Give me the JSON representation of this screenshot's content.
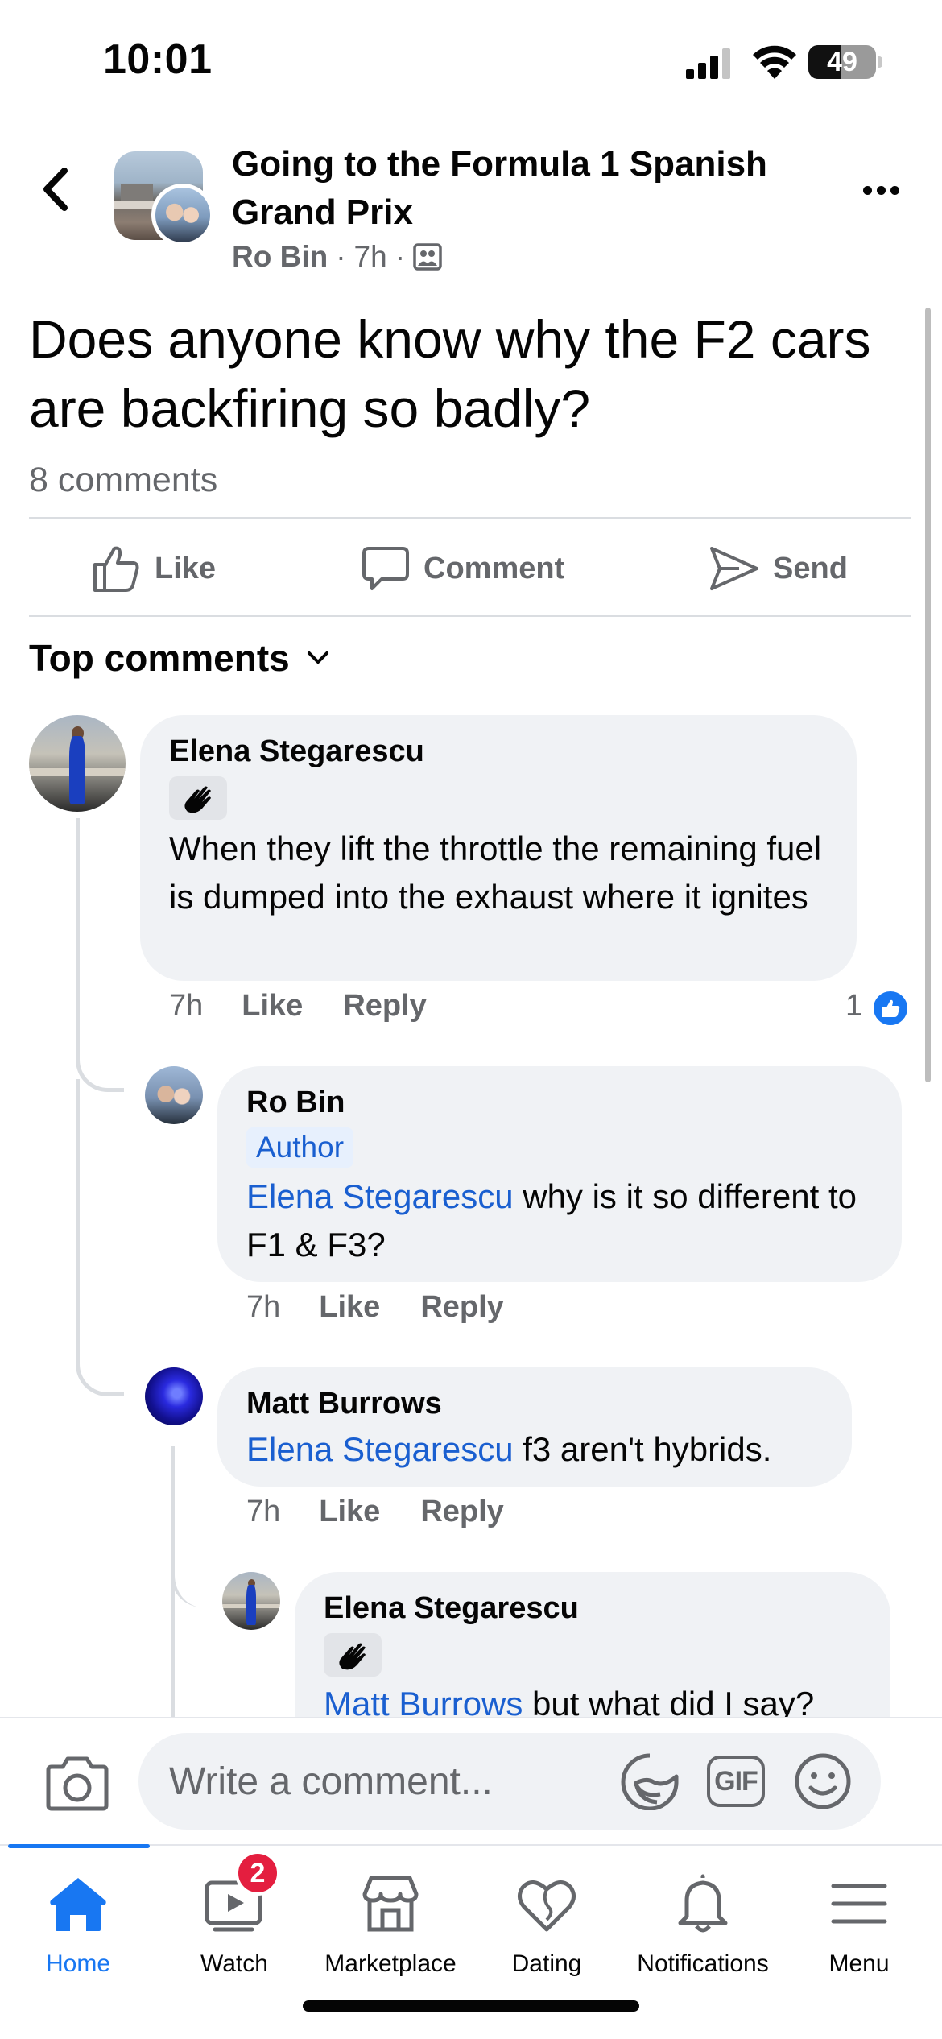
{
  "status_bar": {
    "time": "10:01",
    "battery_level": "49"
  },
  "header": {
    "group_title": "Going to the Formula 1 Spanish Grand Prix",
    "author": "Ro Bin",
    "time": "7h"
  },
  "post": {
    "text": "Does anyone know why the F2 cars are backfiring so badly?",
    "comment_count": "8 comments"
  },
  "actions": {
    "like": "Like",
    "comment": "Comment",
    "send": "Send"
  },
  "comments_section": {
    "sort_label": "Top comments"
  },
  "comments": [
    {
      "author": "Elena Stegarescu",
      "text": "When they lift the throttle the remaining fuel is dumped into the exhaust where it ignites",
      "time": "7h",
      "like": "Like",
      "reply": "Reply",
      "reaction_count": "1"
    },
    {
      "author": "Ro Bin",
      "badge": "Author",
      "mention": "Elena Stegarescu",
      "text": " why is it so different to F1 & F3?",
      "time": "7h",
      "like": "Like",
      "reply": "Reply"
    },
    {
      "author": "Matt Burrows",
      "mention": "Elena Stegarescu",
      "text": " f3 aren't hybrids.",
      "time": "7h",
      "like": "Like",
      "reply": "Reply"
    },
    {
      "author": "Elena Stegarescu",
      "mention": "Matt Burrows",
      "text": " but what did I say?"
    }
  ],
  "composer": {
    "placeholder": "Write a comment...",
    "gif_label": "GIF"
  },
  "tabbar": {
    "active": "Home",
    "items": [
      {
        "label": "Home",
        "icon": "home-icon"
      },
      {
        "label": "Watch",
        "icon": "watch-icon",
        "badge": "2"
      },
      {
        "label": "Marketplace",
        "icon": "marketplace-icon"
      },
      {
        "label": "Dating",
        "icon": "dating-icon"
      },
      {
        "label": "Notifications",
        "icon": "bell-icon"
      },
      {
        "label": "Menu",
        "icon": "menu-icon"
      }
    ]
  },
  "colors": {
    "accent": "#1877f2",
    "mention": "#1a5fd0",
    "bubble": "#f0f2f5",
    "badge_red": "#e41e3f",
    "secondary_text": "#65676b"
  }
}
